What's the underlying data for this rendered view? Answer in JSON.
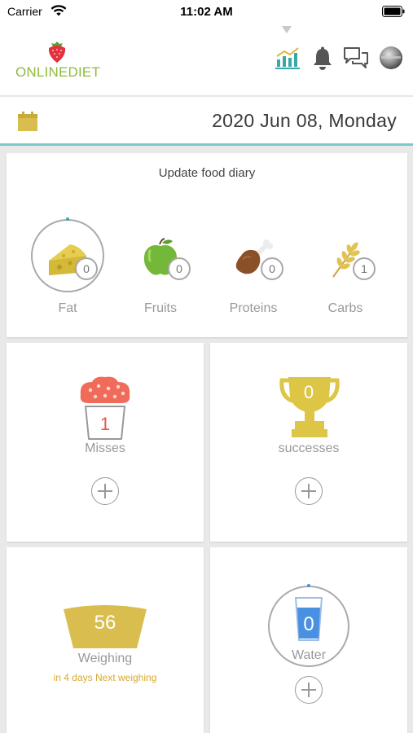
{
  "status": {
    "carrier": "Carrier",
    "time": "11:02 AM"
  },
  "header": {
    "brand_part1": "ONLINE",
    "brand_part2": "DIET"
  },
  "date_bar": {
    "date": "2020 Jun 08, Monday"
  },
  "food_diary": {
    "title": "Update food diary",
    "items": [
      {
        "label": "Fat",
        "count": "0",
        "icon": "cheese-icon"
      },
      {
        "label": "Fruits",
        "count": "0",
        "icon": "apple-icon"
      },
      {
        "label": "Proteins",
        "count": "0",
        "icon": "drumstick-icon"
      },
      {
        "label": "Carbs",
        "count": "1",
        "icon": "wheat-icon"
      }
    ]
  },
  "misses": {
    "count": "1",
    "label": "Misses"
  },
  "successes": {
    "count": "0",
    "label": "successes"
  },
  "weighing": {
    "value": "56",
    "label": "Weighing",
    "next": "in 4 days Next weighing"
  },
  "water": {
    "count": "0",
    "label": "Water"
  },
  "colors": {
    "accent_teal": "#3aa7a8",
    "brand_green": "#8dbb3c",
    "gold": "#d9be4f",
    "misses_red": "#f06b5a",
    "water_blue": "#4a90e2"
  }
}
